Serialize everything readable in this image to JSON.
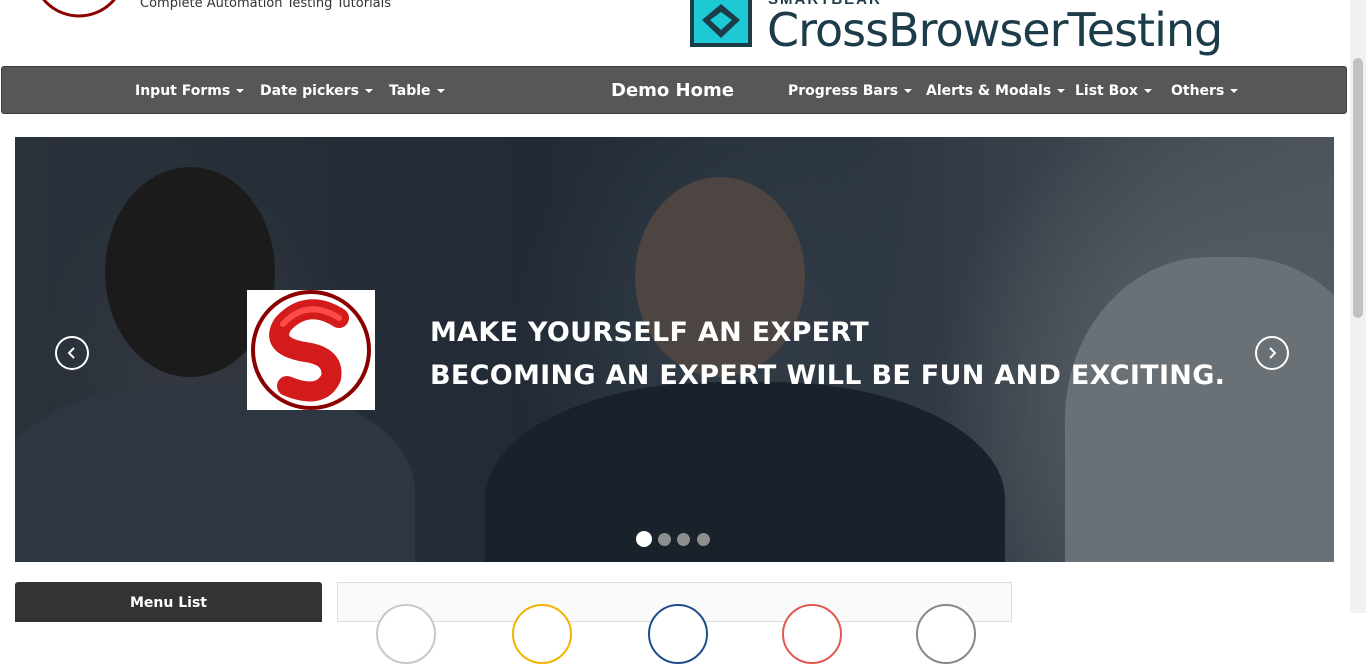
{
  "header": {
    "tagline": "Complete Automation Testing Tutorials",
    "ad_subtitle": "SMARTBEAR",
    "ad_title": "CrossBrowserTesting"
  },
  "nav": {
    "items": [
      {
        "label": "Input Forms"
      },
      {
        "label": "Date pickers"
      },
      {
        "label": "Table"
      },
      {
        "label": "Demo Home"
      },
      {
        "label": "Progress Bars"
      },
      {
        "label": "Alerts & Modals"
      },
      {
        "label": "List Box"
      },
      {
        "label": "Others"
      }
    ]
  },
  "carousel": {
    "line1": "MAKE YOURSELF AN EXPERT",
    "line2": "BECOMING AN EXPERT WILL BE FUN AND EXCITING.",
    "slide_count": 4,
    "active_slide": 1
  },
  "sidebar": {
    "title": "Menu List"
  },
  "colors": {
    "navbar": "#575757",
    "brand_red": "#c4161c",
    "cbt_teal": "#1ec9d6",
    "cbt_navy": "#1c3c4a"
  }
}
